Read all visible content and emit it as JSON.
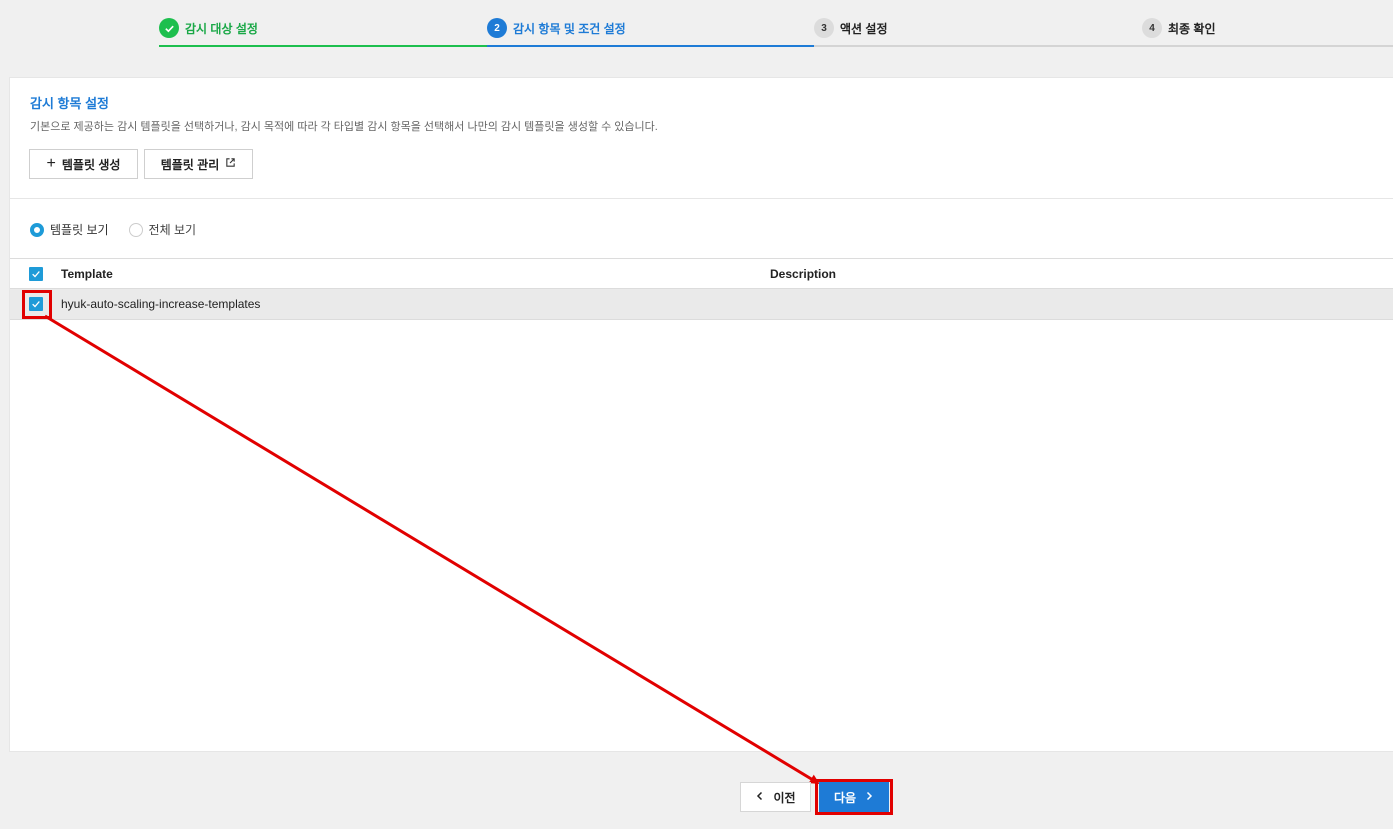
{
  "stepper": {
    "steps": [
      {
        "number": "✓",
        "label": "감시 대상 설정",
        "state": "done"
      },
      {
        "number": "2",
        "label": "감시 항목 및 조건 설정",
        "state": "active"
      },
      {
        "number": "3",
        "label": "액션 설정",
        "state": "pending"
      },
      {
        "number": "4",
        "label": "최종 확인",
        "state": "pending"
      }
    ]
  },
  "section": {
    "title": "감시 항목 설정",
    "description": "기본으로 제공하는 감시 템플릿을 선택하거나, 감시 목적에 따라 각 타입별 감시 항목을 선택해서 나만의 감시 템플릿을 생성할 수 있습니다."
  },
  "buttons": {
    "create_template": "템플릿 생성",
    "manage_template": "템플릿 관리"
  },
  "view_options": {
    "template_view": "템플릿 보기",
    "all_view": "전체 보기",
    "selected": "template_view"
  },
  "table": {
    "headers": {
      "template": "Template",
      "description": "Description"
    },
    "rows": [
      {
        "template": "hyuk-auto-scaling-increase-templates",
        "description": "",
        "checked": true
      }
    ]
  },
  "nav": {
    "prev": "이전",
    "next": "다음"
  },
  "colors": {
    "accent": "#1e7bd6",
    "done": "#1dbf4e",
    "checkbox": "#1e9bd8",
    "highlight": "#e10000"
  }
}
